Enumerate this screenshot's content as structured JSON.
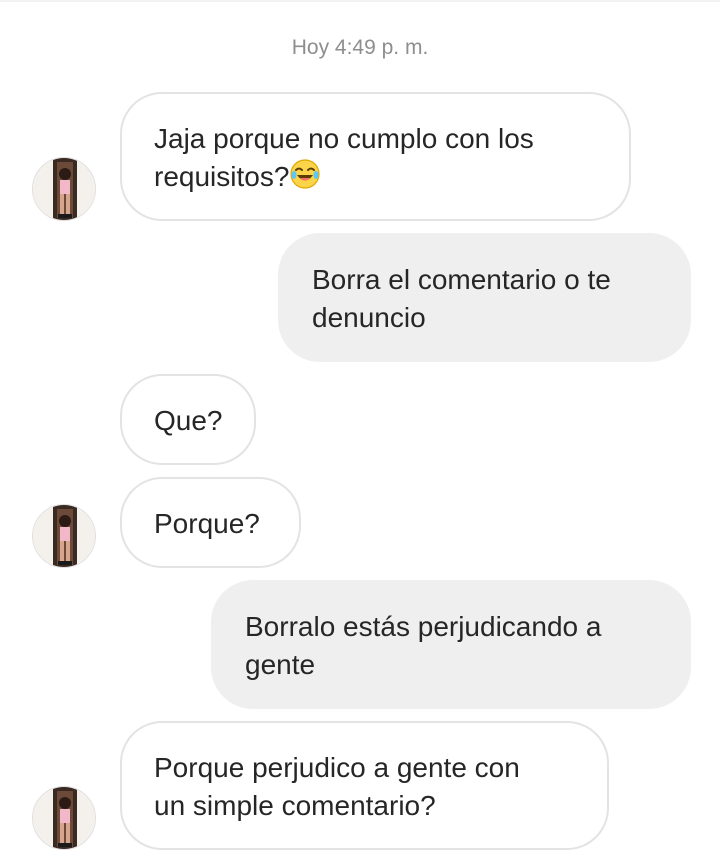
{
  "thread": {
    "timestamp": "Hoy 4:49 p. m.",
    "messages": [
      {
        "direction": "incoming",
        "lines": [
          "Jaja porque no cumplo con los",
          "requisitos?"
        ],
        "emoji": "crying-laughing-emoji"
      },
      {
        "direction": "outgoing",
        "lines": [
          "Borra el comentario o te",
          "denuncio"
        ]
      },
      {
        "direction": "incoming",
        "lines": [
          "Que?"
        ]
      },
      {
        "direction": "incoming",
        "lines": [
          "Porque?"
        ]
      },
      {
        "direction": "outgoing",
        "lines": [
          "Borralo estás perjudicando a",
          "gente"
        ]
      },
      {
        "direction": "incoming",
        "lines": [
          "Porque perjudico a gente con",
          "un simple comentario?"
        ]
      }
    ]
  },
  "colors": {
    "incoming_border": "#e3e3e3",
    "outgoing_background": "#efefef",
    "text": "#262626",
    "timestamp": "#8e8e8e"
  },
  "icons": [
    "avatar",
    "crying-laughing-emoji"
  ]
}
